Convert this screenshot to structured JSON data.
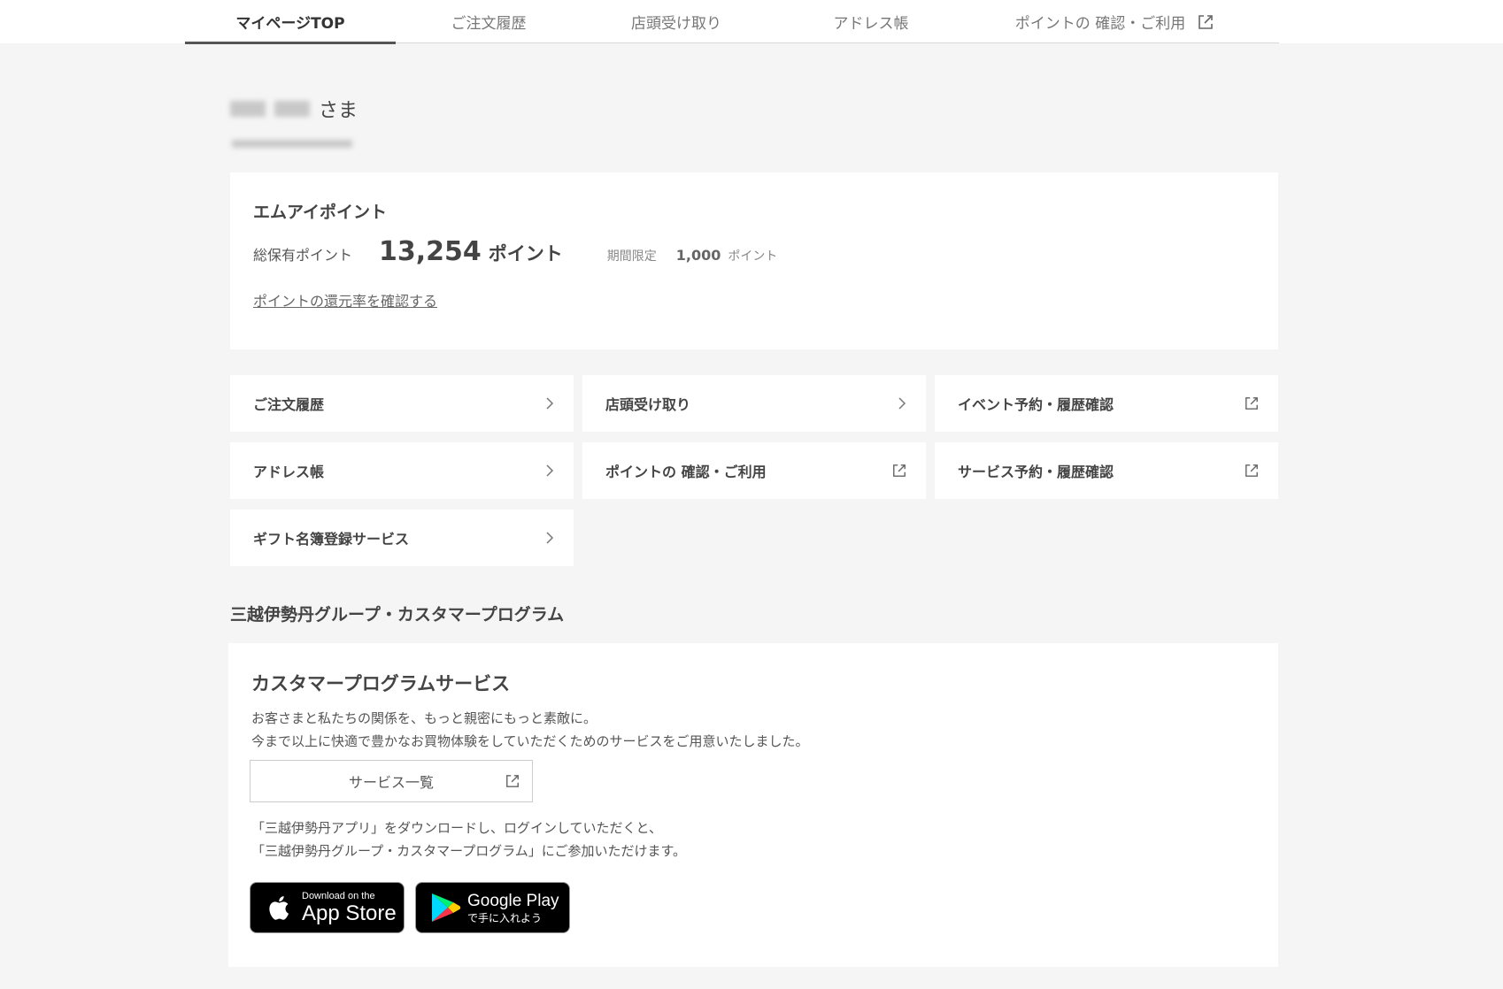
{
  "nav": {
    "tabs": [
      {
        "label": "マイページTOP",
        "active": true
      },
      {
        "label": "ご注文履歴"
      },
      {
        "label": "店頭受け取り"
      },
      {
        "label": "アドレス帳"
      },
      {
        "label": "ポイントの 確認・ご利用",
        "external": true
      }
    ]
  },
  "user": {
    "name_suffix": "さま"
  },
  "points": {
    "title": "エムアイポイント",
    "total_label": "総保有ポイント",
    "total_value": "13,254",
    "total_unit": "ポイント",
    "limited_label": "期間限定",
    "limited_value": "1,000",
    "limited_unit": "ポイント",
    "rate_link": "ポイントの還元率を確認する"
  },
  "menu": {
    "items": [
      {
        "label": "ご注文履歴",
        "icon": "chevron-right-icon"
      },
      {
        "label": "店頭受け取り",
        "icon": "chevron-right-icon"
      },
      {
        "label": "イベント予約・履歴確認",
        "icon": "external-link-icon"
      },
      {
        "label": "アドレス帳",
        "icon": "chevron-right-icon"
      },
      {
        "label": "ポイントの 確認・ご利用",
        "icon": "external-link-icon"
      },
      {
        "label": "サービス予約・履歴確認",
        "icon": "external-link-icon"
      },
      {
        "label": "ギフト名簿登録サービス",
        "icon": "chevron-right-icon"
      }
    ]
  },
  "program": {
    "section_title": "三越伊勢丹グループ・カスタマープログラム",
    "card_title": "カスタマープログラムサービス",
    "desc_line1": "お客さまと私たちの関係を、もっと親密にもっと素敵に。",
    "desc_line2": "今まで以上に快適で豊かなお買物体験をしていただくためのサービスをご用意いたしました。",
    "service_button": "サービス一覧",
    "app_line1": "「三越伊勢丹アプリ」をダウンロードし、ログインしていただくと、",
    "app_line2": "「三越伊勢丹グループ・カスタマープログラム」にご参加いただけます。",
    "appstore_small": "Download on the",
    "appstore_big": "App Store",
    "googleplay_big": "Google Play",
    "googleplay_small": "で手に入れよう"
  },
  "colors": {
    "background": "#f5f5f5",
    "card": "#ffffff",
    "text": "#444444",
    "badge": "#000000"
  }
}
